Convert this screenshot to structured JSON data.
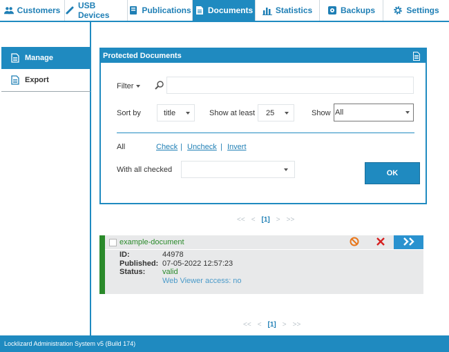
{
  "tabs": [
    {
      "label": "Customers",
      "icon": "users-icon"
    },
    {
      "label": "USB Devices",
      "icon": "usb-icon"
    },
    {
      "label": "Publications",
      "icon": "book-icon"
    },
    {
      "label": "Documents",
      "icon": "document-icon",
      "active": true
    },
    {
      "label": "Statistics",
      "icon": "bar-chart-icon"
    },
    {
      "label": "Backups",
      "icon": "backup-icon"
    },
    {
      "label": "Settings",
      "icon": "gear-icon"
    }
  ],
  "sidebar": {
    "items": [
      {
        "label": "Manage",
        "icon": "document-icon",
        "active": true
      },
      {
        "label": "Export",
        "icon": "document-export-icon"
      }
    ]
  },
  "panel": {
    "title": "Protected Documents",
    "filter_label": "Filter",
    "filter_value": "",
    "sort_label": "Sort by",
    "sort_value": "title",
    "show_at_least_label": "Show at least",
    "show_at_least_value": "25",
    "show_label": "Show",
    "show_value": "All",
    "all_label": "All",
    "check_link": "Check",
    "uncheck_link": "Uncheck",
    "invert_link": "Invert",
    "separator": "|",
    "with_all_checked_label": "With all checked",
    "with_all_checked_value": "",
    "ok_button": "OK"
  },
  "pager": {
    "first": "<<",
    "prev": "<",
    "current": "[1]",
    "next": ">",
    "last": ">>"
  },
  "document": {
    "name": "example-document",
    "id_label": "ID:",
    "id_value": "44978",
    "published_label": "Published:",
    "published_value": "07-05-2022 12:57:23",
    "status_label": "Status:",
    "status_value": "valid",
    "web_viewer": "Web Viewer access: no"
  },
  "footer": {
    "text": "Locklizard Administration System v5 (Build 174)"
  },
  "colors": {
    "accent": "#1f8ac0",
    "valid_green": "#2a8a2a",
    "link_blue": "#1f7fb5",
    "delete_red": "#d62020",
    "block_orange": "#e8761a"
  }
}
